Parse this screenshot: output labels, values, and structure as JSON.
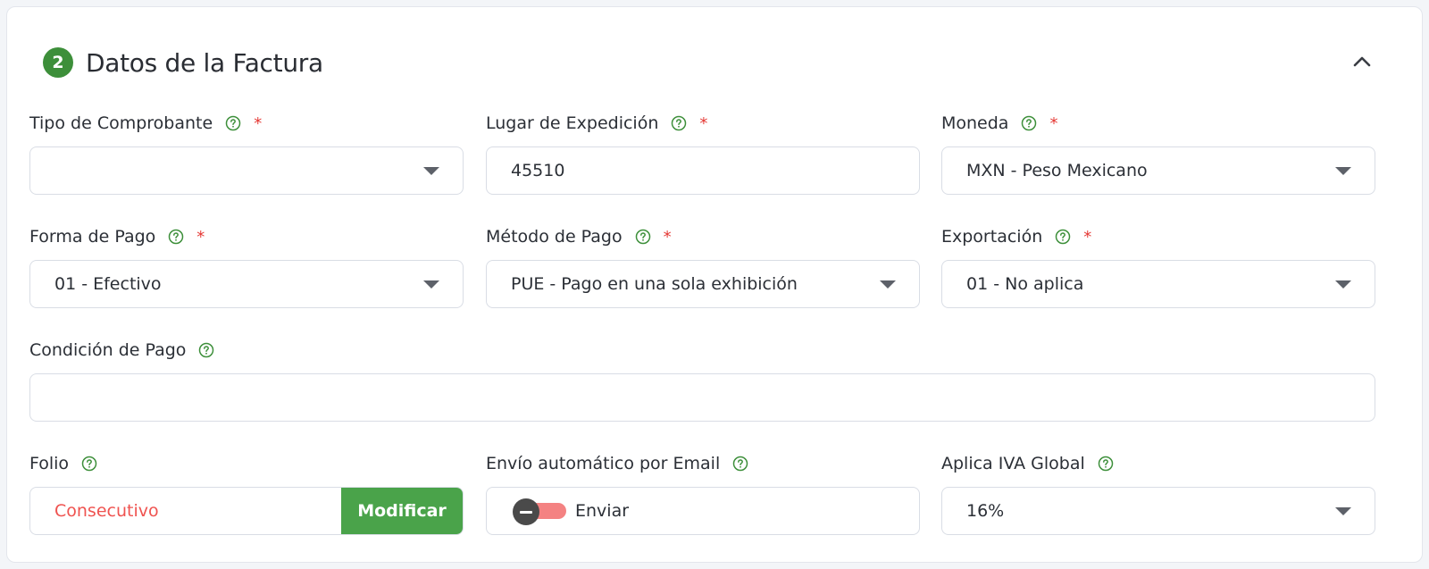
{
  "section": {
    "step": "2",
    "title": "Datos de la Factura"
  },
  "fields": {
    "tipo_comprobante": {
      "label": "Tipo de Comprobante",
      "value": "",
      "required": "*"
    },
    "lugar_expedicion": {
      "label": "Lugar de Expedición",
      "value": "45510",
      "required": "*"
    },
    "moneda": {
      "label": "Moneda",
      "value": "MXN - Peso Mexicano",
      "required": "*"
    },
    "forma_pago": {
      "label": "Forma de Pago",
      "value": "01 - Efectivo",
      "required": "*"
    },
    "metodo_pago": {
      "label": "Método de Pago",
      "value": "PUE - Pago en una sola exhibición",
      "required": "*"
    },
    "exportacion": {
      "label": "Exportación",
      "value": "01 - No aplica",
      "required": "*"
    },
    "condicion_pago": {
      "label": "Condición de Pago",
      "value": ""
    },
    "folio": {
      "label": "Folio",
      "value": "Consecutivo",
      "button": "Modificar"
    },
    "envio_email": {
      "label": "Envío automático por Email",
      "toggle_label": "Enviar",
      "enabled": false
    },
    "iva_global": {
      "label": "Aplica IVA Global",
      "value": "16%"
    }
  },
  "colors": {
    "accent_green": "#3d8f3a",
    "button_green": "#4aa34a",
    "required_red": "#e53935",
    "folio_red": "#ef5350",
    "help_icon_green": "#3d8f3a",
    "toggle_track": "#f48282"
  },
  "icons": {
    "help": "help-circle-icon",
    "collapse": "chevron-up-icon",
    "dropdown": "caret-down-icon"
  }
}
